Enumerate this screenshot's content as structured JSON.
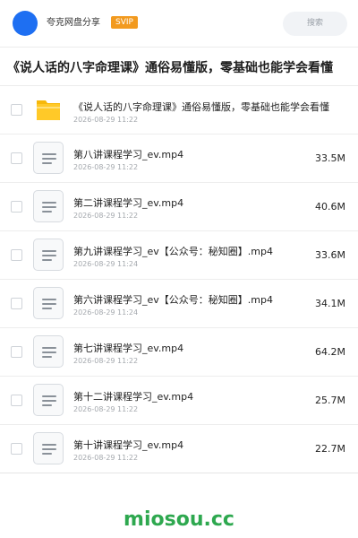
{
  "header": {
    "user_name": "夸克网盘分享",
    "badge": "SVIP",
    "search_placeholder": "搜索"
  },
  "colors": {
    "avatar": "#1e6ff2",
    "badge": "#f29a1f",
    "brand": "#2ea84f"
  },
  "page_title": "《说人话的八字命理课》通俗易懂版，零基础也能学会看懂",
  "folder": {
    "name": "《说人话的八字命理课》通俗易懂版，零基础也能学会看懂",
    "date": "2026-08-29 11:22",
    "icon": "folder-icon"
  },
  "files": [
    {
      "name": "第八讲课程学习_ev.mp4",
      "date": "2026-08-29 11:22",
      "size": "33.5M"
    },
    {
      "name": "第二讲课程学习_ev.mp4",
      "date": "2026-08-29 11:22",
      "size": "40.6M"
    },
    {
      "name": "第九讲课程学习_ev【公众号：秘知圈】.mp4",
      "date": "2026-08-29 11:24",
      "size": "33.6M"
    },
    {
      "name": "第六讲课程学习_ev【公众号：秘知圈】.mp4",
      "date": "2026-08-29 11:24",
      "size": "34.1M"
    },
    {
      "name": "第七讲课程学习_ev.mp4",
      "date": "2026-08-29 11:22",
      "size": "64.2M"
    },
    {
      "name": "第十二讲课程学习_ev.mp4",
      "date": "2026-08-29 11:22",
      "size": "25.7M"
    },
    {
      "name": "第十讲课程学习_ev.mp4",
      "date": "2026-08-29 11:22",
      "size": "22.7M"
    }
  ],
  "footer_brand": "miosou.cc"
}
